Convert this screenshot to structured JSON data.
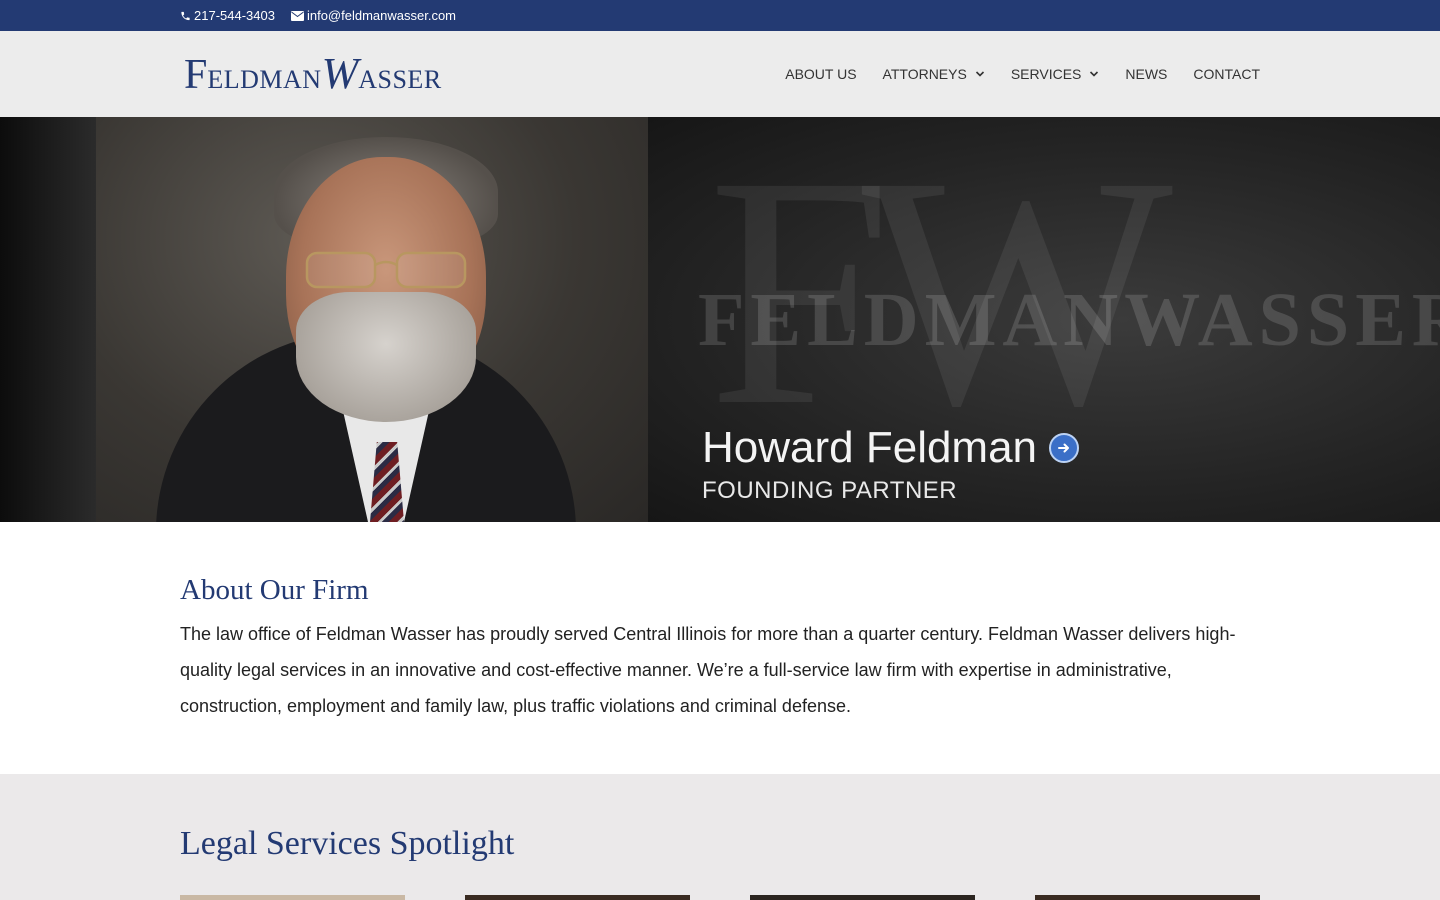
{
  "topbar": {
    "phone": "217-544-3403",
    "email": "info@feldmanwasser.com"
  },
  "header": {
    "logo": {
      "first_initial": "F",
      "first_rest": "ELDMAN",
      "second_initial": "W",
      "second_rest": "ASSER"
    },
    "nav": [
      {
        "label": "ABOUT US",
        "has_dropdown": false
      },
      {
        "label": "ATTORNEYS",
        "has_dropdown": true
      },
      {
        "label": "SERVICES",
        "has_dropdown": true
      },
      {
        "label": "NEWS",
        "has_dropdown": false
      },
      {
        "label": "CONTACT",
        "has_dropdown": false
      }
    ]
  },
  "hero": {
    "watermark": "FELDMANWASSER",
    "monogram": "FW",
    "name": "Howard Feldman",
    "role": "FOUNDING PARTNER"
  },
  "about": {
    "title": "About Our Firm",
    "body": "The law office of Feldman Wasser has proudly served Central Illinois for more than a quarter century. Feldman Wasser delivers high-quality legal services in an innovative and cost-effective manner. We’re a full-service law firm with expertise in administrative, construction, employment and family law, plus traffic violations and criminal defense."
  },
  "spotlight": {
    "title": "Legal Services Spotlight",
    "card_colors": [
      "#c9b8a4",
      "#3a2b22",
      "#2b2520",
      "#3a2b22"
    ]
  },
  "colors": {
    "brand_navy": "#233a73",
    "header_bg": "#ececec",
    "spotlight_bg": "#ebe9ea"
  }
}
